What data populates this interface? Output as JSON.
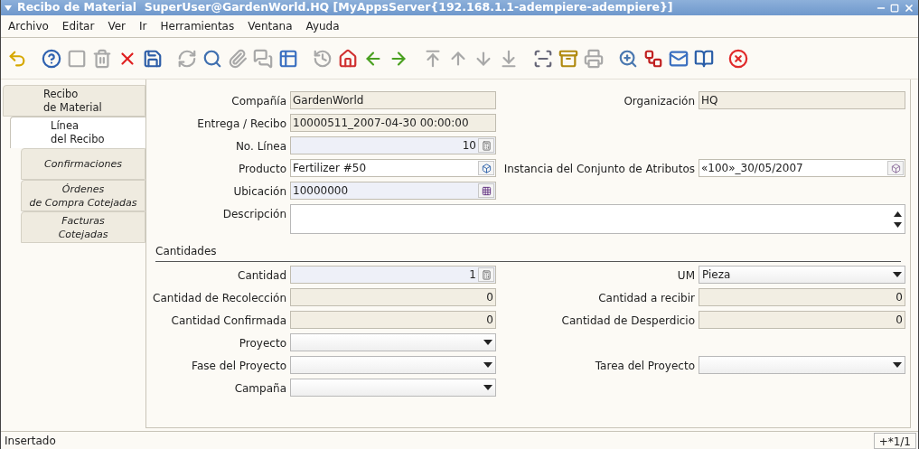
{
  "window": {
    "title": "Recibo de Material  SuperUser@GardenWorld.HQ [MyAppsServer{192.168.1.1-adempiere-adempiere}]"
  },
  "menu": [
    "Archivo",
    "Editar",
    "Ver",
    "Ir",
    "Herramientas",
    "Ventana",
    "Ayuda"
  ],
  "toolbar": [
    [
      {
        "kind": "undo",
        "disabled": false
      }
    ],
    [
      {
        "kind": "help",
        "disabled": false
      },
      {
        "kind": "new",
        "disabled": true
      },
      {
        "kind": "delete",
        "disabled": true
      },
      {
        "kind": "delete_selection",
        "disabled": false
      },
      {
        "kind": "save",
        "disabled": false
      }
    ],
    [
      {
        "kind": "refresh",
        "disabled": true
      },
      {
        "kind": "find",
        "disabled": false
      },
      {
        "kind": "attachment",
        "disabled": true
      },
      {
        "kind": "chat",
        "disabled": true
      },
      {
        "kind": "grid",
        "disabled": false
      }
    ],
    [
      {
        "kind": "history",
        "disabled": true
      },
      {
        "kind": "home",
        "disabled": false
      },
      {
        "kind": "back",
        "disabled": false
      },
      {
        "kind": "forward",
        "disabled": false
      }
    ],
    [
      {
        "kind": "first",
        "disabled": true
      },
      {
        "kind": "previous",
        "disabled": true
      },
      {
        "kind": "next",
        "disabled": true
      },
      {
        "kind": "last",
        "disabled": true
      }
    ],
    [
      {
        "kind": "report",
        "disabled": false
      },
      {
        "kind": "archive",
        "disabled": false
      },
      {
        "kind": "print",
        "disabled": true
      }
    ],
    [
      {
        "kind": "zoom_across",
        "disabled": false
      },
      {
        "kind": "workflow",
        "disabled": false
      },
      {
        "kind": "request",
        "disabled": false
      },
      {
        "kind": "product",
        "disabled": false
      }
    ],
    [
      {
        "kind": "exit",
        "disabled": false
      }
    ]
  ],
  "tabs": [
    {
      "label": "Recibo\nde Material",
      "selected": false,
      "read_only": false,
      "children": [
        {
          "label": "Línea\ndel Recibo",
          "selected": true,
          "read_only": false,
          "children": [
            {
              "label": "Confirmaciones",
              "selected": false,
              "read_only": true
            },
            {
              "label": "Órdenes\nde Compra Cotejadas",
              "selected": false,
              "read_only": true
            },
            {
              "label": "Facturas\nCotejadas",
              "selected": false,
              "read_only": true
            }
          ]
        }
      ]
    }
  ],
  "form": {
    "rows": [
      {
        "fields": [
          {
            "label": "Compañía",
            "value": "GardenWorld",
            "kind": "text",
            "read_only": true,
            "mandatory": false
          },
          {
            "label": "Organización",
            "value": "HQ",
            "kind": "text",
            "read_only": true,
            "mandatory": false
          }
        ]
      },
      {
        "fields": [
          {
            "label": "Entrega / Recibo",
            "value": "10000511_2007-04-30 00:00:00",
            "kind": "text",
            "read_only": true,
            "mandatory": false
          }
        ]
      },
      {
        "fields": [
          {
            "label": "No. Línea",
            "value": "10",
            "kind": "number",
            "read_only": false,
            "mandatory": true
          }
        ]
      },
      {
        "fields": [
          {
            "label": "Producto",
            "value": "Fertilizer #50",
            "kind": "search",
            "read_only": false,
            "mandatory": false
          },
          {
            "label": "Instancia del Conjunto de Atributos",
            "value": "«100»_30/05/2007",
            "kind": "attribute",
            "read_only": false,
            "mandatory": false
          }
        ]
      },
      {
        "fields": [
          {
            "label": "Ubicación",
            "value": "10000000",
            "kind": "locator",
            "read_only": false,
            "mandatory": true
          }
        ]
      },
      {
        "fields": [
          {
            "label": "Descripción",
            "kind": "textarea",
            "read_only": false,
            "mandatory": false
          }
        ]
      },
      {
        "section": "Cantidades"
      },
      {
        "fields": [
          {
            "label": "Cantidad",
            "value": "1",
            "kind": "number",
            "read_only": false,
            "mandatory": true
          },
          {
            "label": "UM",
            "value": "Pieza",
            "kind": "combo",
            "read_only": false,
            "mandatory": false
          }
        ]
      },
      {
        "fields": [
          {
            "label": "Cantidad de Recolección",
            "value": "0",
            "kind": "amount",
            "read_only": true,
            "mandatory": false
          },
          {
            "label": "Cantidad a recibir",
            "value": "0",
            "kind": "amount",
            "read_only": true,
            "mandatory": false
          }
        ]
      },
      {
        "fields": [
          {
            "label": "Cantidad Confirmada",
            "value": "0",
            "kind": "amount",
            "read_only": true,
            "mandatory": false
          },
          {
            "label": "Cantidad de Desperdicio",
            "value": "0",
            "kind": "amount",
            "read_only": true,
            "mandatory": false
          }
        ]
      },
      {
        "fields": [
          {
            "label": "Proyecto",
            "kind": "combo",
            "read_only": false,
            "mandatory": false
          }
        ]
      },
      {
        "fields": [
          {
            "label": "Fase del Proyecto",
            "kind": "combo",
            "read_only": false,
            "mandatory": false
          },
          {
            "label": "Tarea del Proyecto",
            "kind": "combo",
            "read_only": false,
            "mandatory": false
          }
        ]
      },
      {
        "fields": [
          {
            "label": "Campaña",
            "kind": "combo",
            "read_only": false,
            "mandatory": false
          }
        ]
      }
    ]
  },
  "status_bar": {
    "message": "Insertado",
    "record": "+*1/1"
  }
}
